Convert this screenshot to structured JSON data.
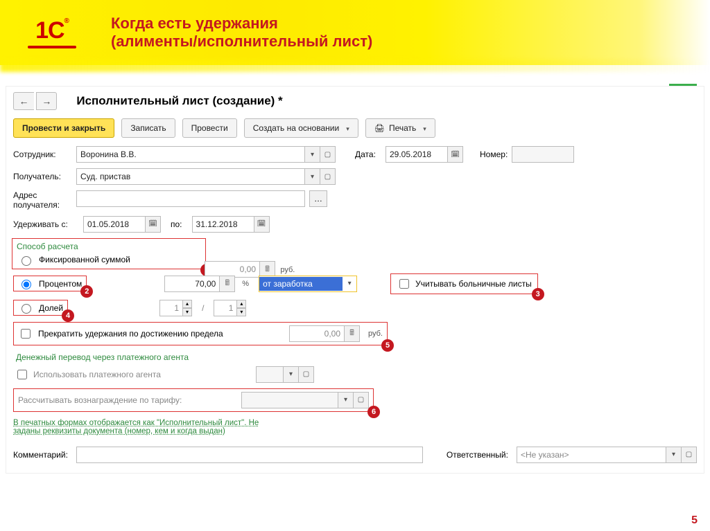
{
  "banner": {
    "logo": "1С",
    "title_line1": "Когда есть удержания",
    "title_line2": "(алименты/исполнительный лист)"
  },
  "page": {
    "title": "Исполнительный лист (создание) *"
  },
  "toolbar": {
    "post_close": "Провести и закрыть",
    "save": "Записать",
    "post": "Провести",
    "create_based": "Создать на основании",
    "print": "Печать"
  },
  "fields": {
    "employee_label": "Сотрудник:",
    "employee_value": "Воронина В.В.",
    "date_label": "Дата:",
    "date_value": "29.05.2018",
    "number_label": "Номер:",
    "number_value": "",
    "recipient_label": "Получатель:",
    "recipient_value": "Суд. пристав",
    "address_label_l1": "Адрес",
    "address_label_l2": "получателя:",
    "address_value": "",
    "hold_from_label": "Удерживать с:",
    "hold_from_value": "01.05.2018",
    "hold_to_label": "по:",
    "hold_to_value": "31.12.2018"
  },
  "calc": {
    "section": "Способ расчета",
    "option_fixed": "Фиксированной суммой",
    "fixed_value": "0,00",
    "fixed_unit": "руб.",
    "option_percent": "Процентом",
    "percent_value": "70,00",
    "percent_unit": "%",
    "percent_base": "от заработка",
    "option_share": "Долей",
    "share_num": "1",
    "share_den": "1",
    "sick_leave": "Учитывать больничные листы",
    "stop_at_limit": "Прекратить удержания по достижению предела",
    "limit_value": "0,00",
    "limit_unit": "руб."
  },
  "agent": {
    "section": "Денежный перевод через платежного агента",
    "use_agent": "Использовать платежного агента",
    "tariff_label": "Рассчитывать вознаграждение по тарифу:",
    "tariff_value": ""
  },
  "note": {
    "line1": "В печатных формах отображается как \"Исполнительный лист\". Не",
    "line2": "заданы реквизиты документа (номер, кем и когда выдан)"
  },
  "footer": {
    "comment_label": "Комментарий:",
    "comment_value": "",
    "responsible_label": "Ответственный:",
    "responsible_value": "<Не указан>"
  },
  "badges": {
    "b1": "1",
    "b2": "2",
    "b3": "3",
    "b4": "4",
    "b5": "5",
    "b6": "6"
  },
  "slide_num": "5"
}
